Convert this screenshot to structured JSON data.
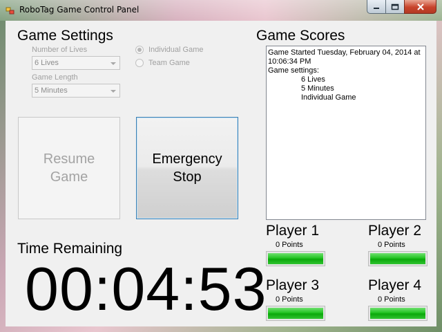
{
  "window": {
    "title": "RoboTag Game Control Panel"
  },
  "settings": {
    "heading": "Game Settings",
    "lives_label": "Number of Lives",
    "lives_value": "6 Lives",
    "length_label": "Game Length",
    "length_value": "5 Minutes",
    "mode_individual": "Individual Game",
    "mode_team": "Team Game"
  },
  "buttons": {
    "resume_line1": "Resume",
    "resume_line2": "Game",
    "stop_line1": "Emergency",
    "stop_line2": "Stop"
  },
  "time": {
    "heading": "Time Remaining",
    "value": "00:04:53"
  },
  "scores": {
    "heading": "Game Scores",
    "log": [
      "Game Started Tuesday, February 04, 2014 at",
      "10:06:34 PM",
      "Game settings:"
    ],
    "settings_log": [
      "6 Lives",
      "5 Minutes",
      "Individual Game"
    ]
  },
  "players": [
    {
      "name": "Player 1",
      "points": "0 Points"
    },
    {
      "name": "Player 2",
      "points": "0 Points"
    },
    {
      "name": "Player 3",
      "points": "0 Points"
    },
    {
      "name": "Player 4",
      "points": "0 Points"
    }
  ],
  "colors": {
    "progress": "#22c322",
    "stop_border": "#3c7fb1"
  }
}
